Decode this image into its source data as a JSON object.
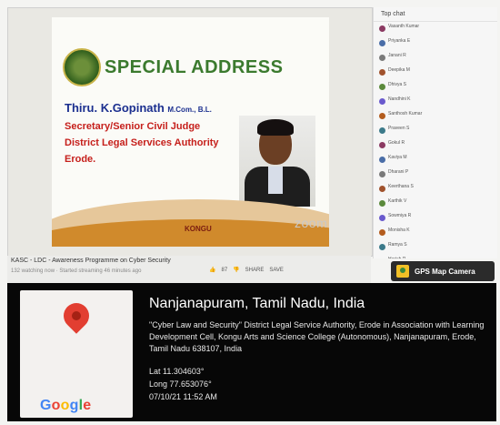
{
  "slide": {
    "heading": "SPECIAL ADDRESS",
    "name": "Thiru. K.Gopinath",
    "degrees": "M.Com., B.L.",
    "lines": [
      "Secretary/Senior Civil Judge",
      "District Legal Services Authority",
      "Erode."
    ],
    "logo_text": "KONGU"
  },
  "zoom_watermark": "zoom",
  "video": {
    "title": "KASC - LDC - Awareness Programme on Cyber Security",
    "subtitle": "132 watching now · Started streaming 46 minutes ago",
    "actions": [
      "87",
      "SHARE",
      "SAVE"
    ]
  },
  "chat": {
    "header": "Top chat",
    "messages": [
      "Vasanth Kumar",
      "Priyanka E",
      "Janani R",
      "Deepika M",
      "Dhivya S",
      "Nandhini K",
      "Santhosh Kumar",
      "Praveen S",
      "Gokul R",
      "Kaviya M",
      "Dharani P",
      "Keerthana S",
      "Karthik V",
      "Sowmiya R",
      "Monisha K",
      "Ramya S",
      "Harish P",
      "Divya K"
    ]
  },
  "gps_badge": "GPS Map Camera",
  "location": {
    "place": "Nanjanapuram, Tamil Nadu, India",
    "address": "\"Cyber Law and Security\" District Legal Service Authority, Erode in Association with Learning Development Cell, Kongu Arts and Science College (Autonomous), Nanjanapuram, Erode, Tamil Nadu 638107, India",
    "lat": "Lat 11.304603°",
    "long": "Long 77.653076°",
    "datetime": "07/10/21 11:52 AM"
  },
  "google_logo": "Google"
}
